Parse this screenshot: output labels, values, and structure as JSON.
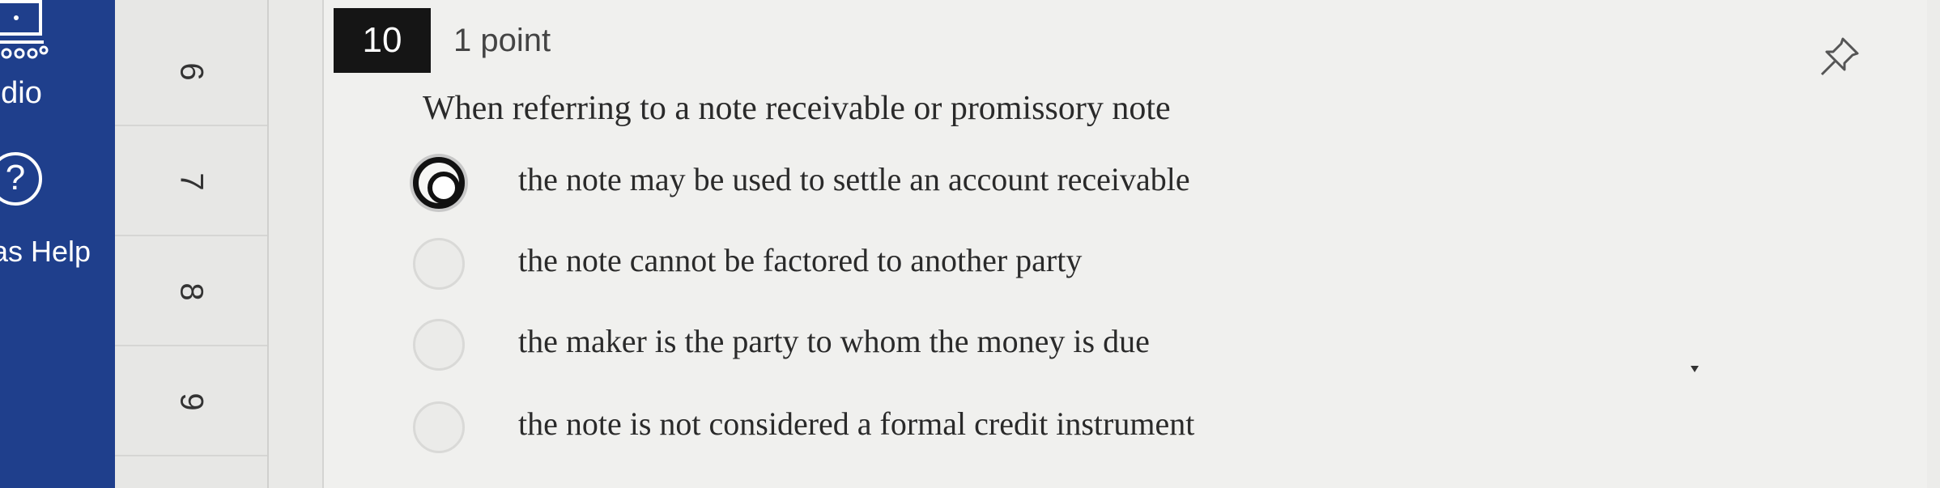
{
  "global_nav": {
    "studio_label": "udio",
    "help_label": "as Help",
    "help_icon_glyph": "?"
  },
  "question_nav": {
    "items": [
      {
        "label": "6"
      },
      {
        "label": "7"
      },
      {
        "label": "8"
      },
      {
        "label": "9"
      }
    ]
  },
  "question": {
    "number": "10",
    "points": "1 point",
    "prompt": "When referring to a note receivable or promissory note",
    "options": [
      {
        "label": "the note may be used to settle an account receivable",
        "selected": true
      },
      {
        "label": "the note cannot be factored to another party",
        "selected": false
      },
      {
        "label": "the maker is the party to whom the money is due",
        "selected": false
      },
      {
        "label": "the note is not considered a formal credit instrument",
        "selected": false
      }
    ]
  },
  "colors": {
    "nav_background": "#1f3f8c",
    "question_number_background": "#151515"
  },
  "icons": {
    "studio": "studio-icon",
    "help": "help-icon",
    "pin": "pin-icon"
  }
}
